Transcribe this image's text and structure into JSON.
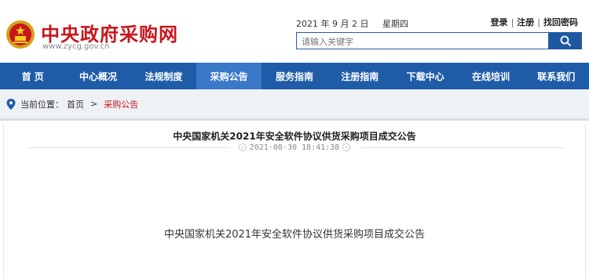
{
  "header": {
    "site_title": "中央政府采购网",
    "site_url": "www.zycg.gov.cn",
    "date": "2021 年 9 月 2 日",
    "weekday": "星期四",
    "auth_links": [
      "登录",
      "注册",
      "找回密码"
    ],
    "search_placeholder": "请输入关键字",
    "emblem_icon": "national-emblem-icon",
    "search_icon": "search-icon"
  },
  "nav": {
    "items": [
      "首 页",
      "中心概况",
      "法规制度",
      "采购公告",
      "服务指南",
      "注册指南",
      "下载中心",
      "在线培训",
      "联系我们"
    ],
    "active_index": 3
  },
  "breadcrumb": {
    "label": "当前位置：",
    "home": "首页",
    "separator": ">",
    "current": "采购公告"
  },
  "article": {
    "title": "中央国家机关2021年安全软件协议供货采购项目成交公告",
    "timestamp": "2021-08-30 18:41:38",
    "body": "中央国家机关2021年安全软件协议供货采购项目成交公告"
  },
  "colors": {
    "brand_red": "#c8161d",
    "nav_blue": "#1f5ca8",
    "nav_active": "#3a78c8",
    "search_blue": "#1e58a3"
  }
}
